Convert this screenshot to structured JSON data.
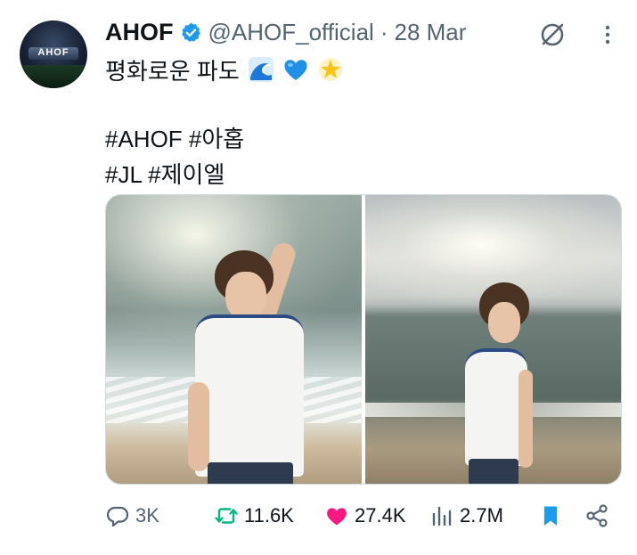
{
  "author": {
    "display_name": "AHOF",
    "handle": "@AHOF_official",
    "separator": "·",
    "date": "28 Mar",
    "avatar_text": "AHOF",
    "verified_color": "#1d9bf0"
  },
  "tweet": {
    "line1": "평화로운 파도",
    "line1_emojis": [
      "wave-emoji",
      "blue-heart-emoji",
      "glowing-star-emoji"
    ],
    "line3": "#AHOF #아홉",
    "line4": "#JL #제이엘"
  },
  "media": {
    "count": 2,
    "items": [
      "beach-photo-1",
      "beach-photo-2"
    ]
  },
  "actions": {
    "replies": "3K",
    "reposts": "11.6K",
    "likes": "27.4K",
    "views": "2.7M"
  },
  "colors": {
    "text": "#0f1419",
    "muted": "#536471",
    "retweet": "#00ba7c",
    "like": "#f91880",
    "bookmark": "#1d9bf0"
  }
}
